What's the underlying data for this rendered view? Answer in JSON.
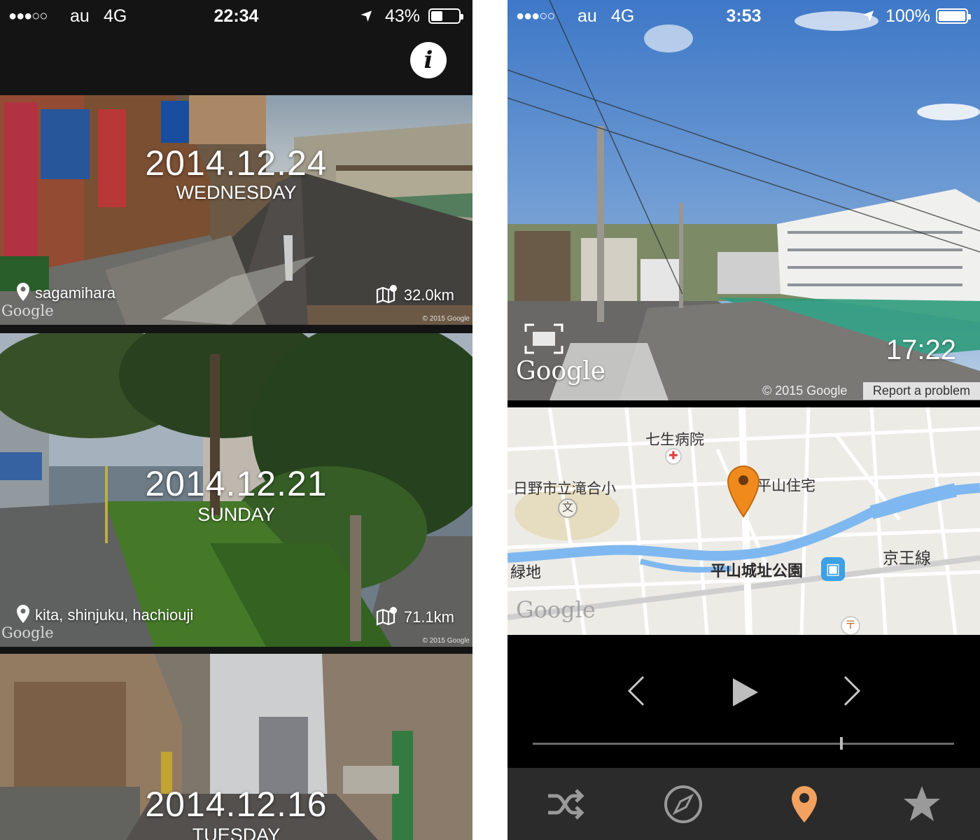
{
  "left": {
    "status": {
      "signal": "●●●○○",
      "carrier": "au",
      "network": "4G",
      "time": "22:34",
      "battery": "43%",
      "battery_level": 0.43
    },
    "header": {
      "info_label": "i",
      "info_icon": "info-icon"
    },
    "cards": [
      {
        "date": "2014.12.24",
        "day": "WEDNESDAY",
        "location": "sagamihara",
        "distance": "32.0km",
        "watermark": "Google",
        "copyright": "© 2015 Google"
      },
      {
        "date": "2014.12.21",
        "day": "SUNDAY",
        "location": "kita, shinjuku, hachiouji",
        "distance": "71.1km",
        "watermark": "Google",
        "copyright": "© 2015 Google"
      },
      {
        "date": "2014.12.16",
        "day": "TUESDAY"
      }
    ]
  },
  "right": {
    "status": {
      "signal": "●●●○○",
      "carrier": "au",
      "network": "4G",
      "time": "3:53",
      "battery": "100%",
      "battery_level": 1.0
    },
    "street_view": {
      "time": "17:22",
      "watermark": "Google",
      "copyright": "© 2015 Google",
      "report": "Report a problem"
    },
    "map": {
      "labels": [
        "七生病院",
        "日野市立滝合小",
        "平山住宅",
        "緑地",
        "平山城址公園",
        "京王線"
      ],
      "watermark": "Google",
      "colors": {
        "river": "#7fb8f0",
        "pin": "#f08a1c",
        "park": "#e4dcc4"
      }
    },
    "player": {
      "progress": 0.73,
      "prev_icon": "chevron-left-icon",
      "play_icon": "play-icon",
      "next_icon": "chevron-right-icon"
    },
    "tabs": [
      {
        "name": "shuffle-icon",
        "active": false
      },
      {
        "name": "compass-icon",
        "active": false
      },
      {
        "name": "location-pin-icon",
        "active": true
      },
      {
        "name": "star-icon",
        "active": false
      }
    ],
    "accent": "#f2a15f"
  }
}
